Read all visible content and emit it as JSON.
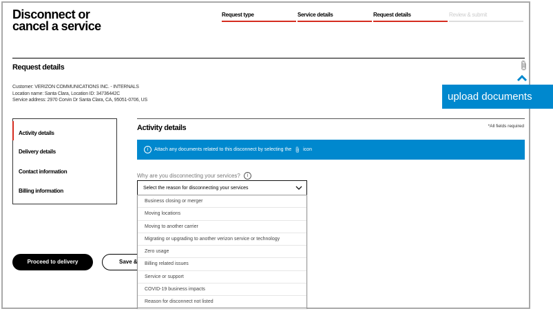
{
  "header": {
    "title_line1": "Disconnect or",
    "title_line2": "cancel a service"
  },
  "steps": [
    {
      "label": "Request type",
      "state": "done"
    },
    {
      "label": "Service details",
      "state": "done"
    },
    {
      "label": "Request details",
      "state": "current"
    },
    {
      "label": "Review & submit",
      "state": "upcoming"
    }
  ],
  "request": {
    "heading": "Request details",
    "customer": "Customer: VERIZON COMMUNICATIONS INC. - INTERNALS",
    "location": "Location name: Santa Clara, Location ID: 34736442C",
    "address": "Service address: 2970 Corvin Dr Santa Clara, CA, 95051-0706, US"
  },
  "upload_tooltip": "upload documents",
  "sidebar": {
    "items": [
      {
        "label": "Activity details"
      },
      {
        "label": "Delivery details"
      },
      {
        "label": "Contact information"
      },
      {
        "label": "Billing information"
      }
    ]
  },
  "panel": {
    "heading": "Activity details",
    "required_note": "*All fields required",
    "banner_text": "Attach any documents related to this disconnect by selecting the",
    "banner_suffix": "icon",
    "question": "Why are you disconnecting your services?",
    "select_placeholder": "Select the reason for disconnecting your services",
    "options": [
      "Business closing or merger",
      "Moving locations",
      "Moving to another carrier",
      "Migrating or upgrading to another verizon service or technology",
      "Zero usage",
      "Billing related issues",
      "Service or support",
      "COVID-19 business impacts",
      "Reason for disconnect not listed"
    ]
  },
  "buttons": {
    "proceed": "Proceed to delivery",
    "save": "Save & c"
  },
  "colors": {
    "accent_red": "#d52b1e",
    "info_blue": "#0088ce"
  }
}
